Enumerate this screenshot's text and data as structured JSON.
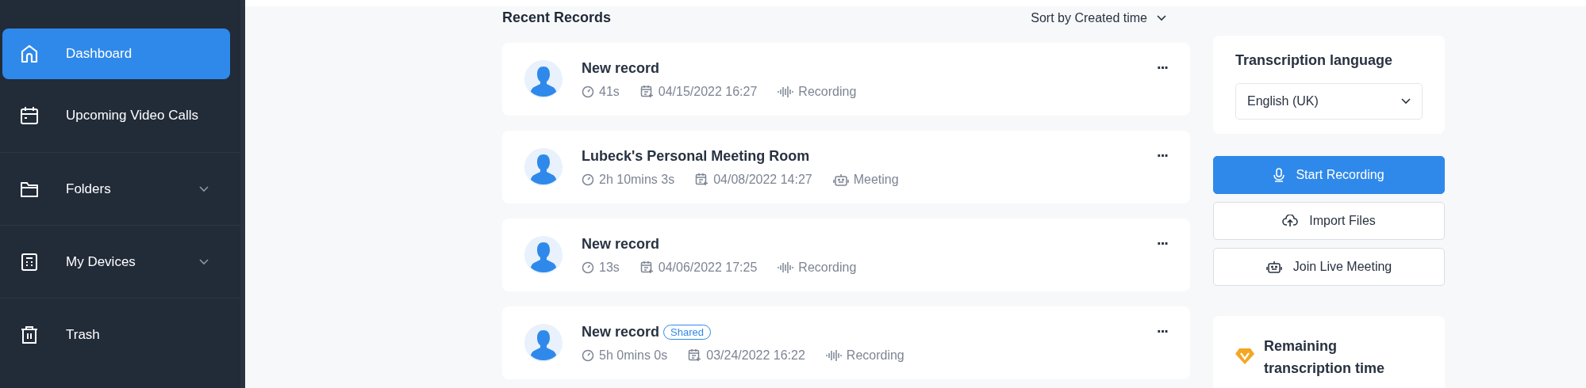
{
  "sidebar": {
    "items": [
      {
        "label": "Dashboard",
        "selected": true,
        "expandable": false
      },
      {
        "label": "Upcoming Video Calls",
        "selected": false,
        "expandable": false
      },
      {
        "label": "Folders",
        "selected": false,
        "expandable": true
      },
      {
        "label": "My Devices",
        "selected": false,
        "expandable": true
      },
      {
        "label": "Trash",
        "selected": false,
        "expandable": false
      }
    ]
  },
  "records": {
    "title": "Recent Records",
    "sort": "Sort by Created time",
    "items": [
      {
        "name": "New record",
        "duration": "41s",
        "date": "04/15/2022 16:27",
        "kind": "recording",
        "type": "Recording",
        "more": "···"
      },
      {
        "name": "Lubeck's Personal Meeting Room",
        "duration": "2h 10mins 3s",
        "date": "04/08/2022 14:27",
        "kind": "meeting",
        "type": "Meeting",
        "more": "···"
      },
      {
        "name": "New record",
        "duration": "13s",
        "date": "04/06/2022 17:25",
        "kind": "recording",
        "type": "Recording",
        "more": "···"
      },
      {
        "name": "New record",
        "badge": "Shared",
        "duration": "5h 0mins 0s",
        "date": "03/24/2022 16:22",
        "kind": "recording",
        "type": "Recording",
        "more": "···"
      }
    ]
  },
  "panel": {
    "language_title": "Transcription language",
    "language": "English (UK)",
    "buttons": [
      {
        "label": "Start Recording",
        "kind": "primary"
      },
      {
        "label": "Import Files",
        "kind": "upload"
      },
      {
        "label": "Join Live Meeting",
        "kind": "meeting"
      }
    ],
    "remaining_title": "Remaining transcription time"
  }
}
